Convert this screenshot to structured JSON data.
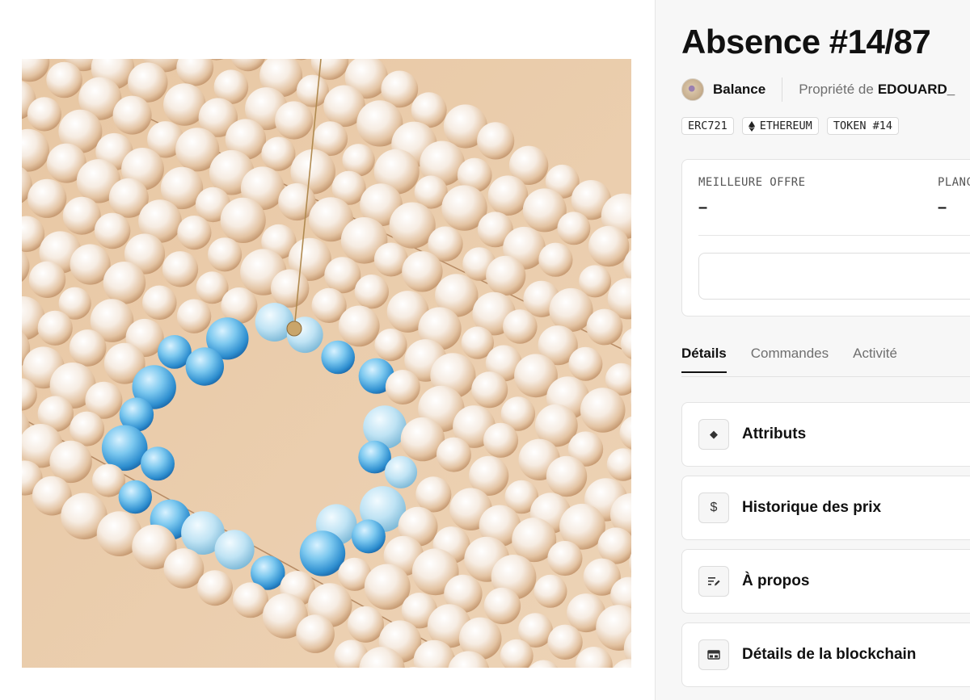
{
  "artwork": {
    "description_icon": "artwork-image"
  },
  "nft": {
    "title": "Absence #14/87",
    "creator": "Balance",
    "owner_prefix": "Propriété de",
    "owner": "EDOUARD_"
  },
  "chips": [
    {
      "label": "ERC721",
      "icon": ""
    },
    {
      "label": "ETHEREUM",
      "icon": "ethereum-icon"
    },
    {
      "label": "TOKEN #14",
      "icon": ""
    }
  ],
  "offer": {
    "best_offer_label": "MEILLEURE OFFRE",
    "best_offer_value": "–",
    "floor_label": "PLANC",
    "floor_value": "–"
  },
  "tabs": [
    {
      "label": "Détails",
      "active": true
    },
    {
      "label": "Commandes",
      "active": false
    },
    {
      "label": "Activité",
      "active": false
    }
  ],
  "sections": [
    {
      "label": "Attributs",
      "icon": "diamond-icon",
      "glyph": "◆"
    },
    {
      "label": "Historique des prix",
      "icon": "dollar-icon",
      "glyph": "$"
    },
    {
      "label": "À propos",
      "icon": "notes-edit-icon",
      "glyph": ""
    },
    {
      "label": "Détails de la blockchain",
      "icon": "blockchain-block-icon",
      "glyph": ""
    }
  ],
  "colors": {
    "panel_bg": "#f7f7f7",
    "artwork_bg": "#e9c9a6",
    "pearl": "#f4e7d9",
    "blue_bead": "#5fb6e6"
  }
}
